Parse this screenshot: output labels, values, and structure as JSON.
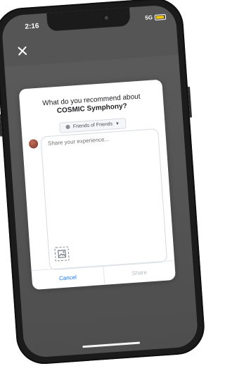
{
  "status": {
    "time": "2:16",
    "signal": "5G"
  },
  "header": {
    "close_icon": "close-icon"
  },
  "modal": {
    "question_prefix": "What do you recommend about",
    "question_subject": "COSMIC Symphony?",
    "audience": "Friends of Friends",
    "placeholder": "Share your experience...",
    "cancel": "Cancel",
    "share": "Share"
  }
}
